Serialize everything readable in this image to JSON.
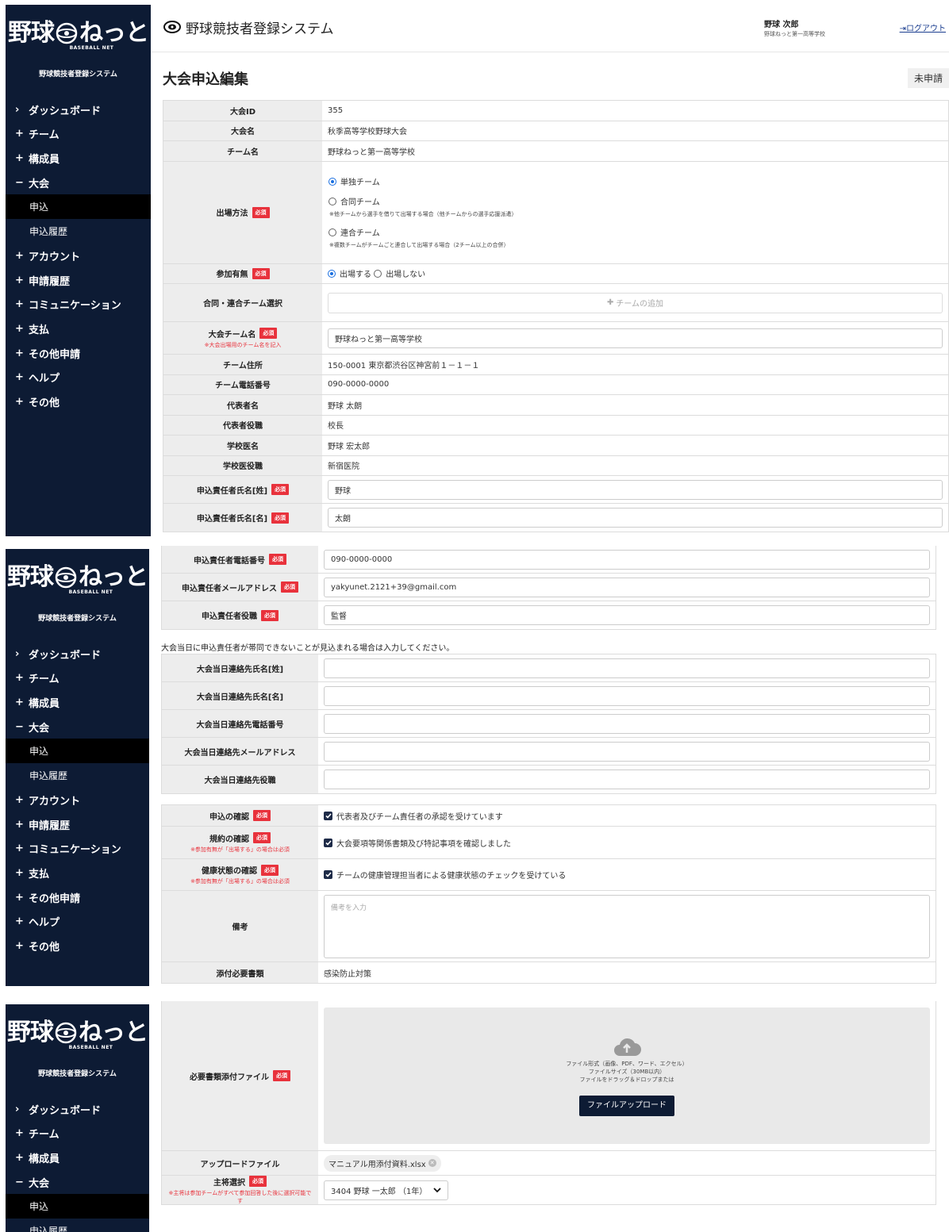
{
  "brand": {
    "logo_left": "野球",
    "logo_right": "ねっと",
    "logo_sub": "BASEBALL NET",
    "system_name": "野球競技者登録システム"
  },
  "sidebar": {
    "menu": [
      {
        "sym": "›",
        "label": "ダッシュボード"
      },
      {
        "sym": "+",
        "label": "チーム"
      },
      {
        "sym": "+",
        "label": "構成員"
      },
      {
        "sym": "−",
        "label": "大会"
      },
      {
        "sym": "+",
        "label": "アカウント"
      },
      {
        "sym": "+",
        "label": "申請履歴"
      },
      {
        "sym": "+",
        "label": "コミュニケーション"
      },
      {
        "sym": "+",
        "label": "支払"
      },
      {
        "sym": "+",
        "label": "その他申請"
      },
      {
        "sym": "+",
        "label": "ヘルプ"
      },
      {
        "sym": "+",
        "label": "その他"
      }
    ],
    "submenu": [
      {
        "label": "申込"
      },
      {
        "label": "申込履歴"
      }
    ]
  },
  "header": {
    "title": "野球競技者登録システム",
    "user_name": "野球 次郎",
    "user_school": "野球ねっと第一高等学校",
    "logout": "ログアウト"
  },
  "page": {
    "title": "大会申込編集",
    "status": "未申請"
  },
  "form": {
    "tournament_id": {
      "label": "大会ID",
      "value": "355"
    },
    "tournament_name": {
      "label": "大会名",
      "value": "秋季高等学校野球大会"
    },
    "team_name": {
      "label": "チーム名",
      "value": "野球ねっと第一高等学校"
    },
    "entry_method": {
      "label": "出場方法",
      "options": [
        {
          "label": "単独チーム",
          "note": "",
          "selected": true
        },
        {
          "label": "合同チーム",
          "note": "※他チームから選手を借りて出場する場合（他チームからの選手応援派遣）",
          "selected": false
        },
        {
          "label": "連合チーム",
          "note": "※複数チームがチームごと連合して出場する場合（2チーム以上の合併）",
          "selected": false
        }
      ]
    },
    "participation": {
      "label": "参加有無",
      "yes": "出場する",
      "no": "出場しない"
    },
    "joint_team": {
      "label": "合同・連合チーム選択",
      "add_button": "チームの追加"
    },
    "tournament_team_name": {
      "label": "大会チーム名",
      "note": "※大会出場用のチーム名を記入",
      "value": "野球ねっと第一高等学校"
    },
    "team_address": {
      "label": "チーム住所",
      "value": "150-0001 東京都渋谷区神宮前１－１－１"
    },
    "team_phone": {
      "label": "チーム電話番号",
      "value": "090-0000-0000"
    },
    "representative": {
      "label": "代表者名",
      "value": "野球 太朗"
    },
    "representative_title": {
      "label": "代表者役職",
      "value": "校長"
    },
    "school_doctor": {
      "label": "学校医名",
      "value": "野球 宏太郎"
    },
    "school_doctor_title": {
      "label": "学校医役職",
      "value": "新宿医院"
    },
    "applicant_last": {
      "label": "申込責任者氏名[姓]",
      "value": "野球"
    },
    "applicant_first": {
      "label": "申込責任者氏名[名]",
      "value": "太朗"
    },
    "applicant_phone": {
      "label": "申込責任者電話番号",
      "value": "090-0000-0000"
    },
    "applicant_email": {
      "label": "申込責任者メールアドレス",
      "value": "yakyunet.2121+39@gmail.com"
    },
    "applicant_title": {
      "label": "申込責任者役職",
      "value": "監督"
    },
    "day_contact_note": "大会当日に申込責任者が帯同できないことが見込まれる場合は入力してください。",
    "day_contact_last": {
      "label": "大会当日連絡先氏名[姓]",
      "value": ""
    },
    "day_contact_first": {
      "label": "大会当日連絡先氏名[名]",
      "value": ""
    },
    "day_contact_phone": {
      "label": "大会当日連絡先電話番号",
      "value": ""
    },
    "day_contact_email": {
      "label": "大会当日連絡先メールアドレス",
      "value": ""
    },
    "day_contact_title": {
      "label": "大会当日連絡先役職",
      "value": ""
    },
    "confirm_application": {
      "label": "申込の確認",
      "text": "代表者及びチーム責任者の承認を受けています"
    },
    "confirm_rules": {
      "label": "規約の確認",
      "note": "※参加有無が「出場する」の場合は必須",
      "text": "大会要項等関係書類及び特記事項を確認しました"
    },
    "confirm_health": {
      "label": "健康状態の確認",
      "note": "※参加有無が「出場する」の場合は必須",
      "text": "チームの健康管理担当者による健康状態のチェックを受けている"
    },
    "remarks": {
      "label": "備考",
      "placeholder": "備考を入力"
    },
    "attachment_type": {
      "label": "添付必要書類",
      "value": "感染防止対策"
    },
    "required_files": {
      "label": "必要書類添付ファイル",
      "line1": "ファイル形式（画像、PDF、ワード、エクセル）",
      "line2": "ファイルサイズ（30MB以内）",
      "line3": "ファイルをドラッグ＆ドロップまたは",
      "button": "ファイルアップロード"
    },
    "upload_file": {
      "label": "アップロードファイル",
      "value": "マニュアル用添付資料.xlsx"
    },
    "captain": {
      "label": "主将選択",
      "note": "※主将は参加チームがすべて参加回答した後に選択可能です",
      "value": "3404 野球 一太郎 （1年）"
    }
  },
  "required_badge": "必須"
}
